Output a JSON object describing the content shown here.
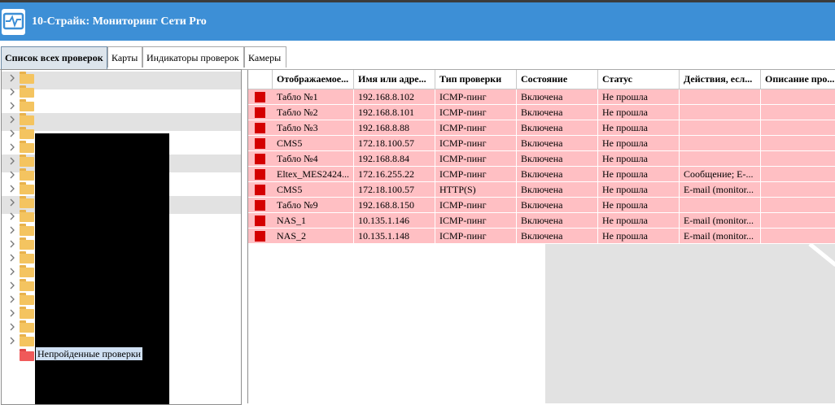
{
  "app": {
    "title": "10-Страйк: Мониторинг Сети Pro",
    "logo_icon": "pulse-monitor-icon"
  },
  "tabs": [
    {
      "label": "Список всех проверок",
      "active": true
    },
    {
      "label": "Карты",
      "active": false
    },
    {
      "label": "Индикаторы проверок",
      "active": false
    },
    {
      "label": "Камеры",
      "active": false
    }
  ],
  "tree": {
    "expand_icon": "chevron-right-icon",
    "folder_icon": "folder-icon",
    "folder_count": 20,
    "failed_checks_label": "Непройденные проверки"
  },
  "grid": {
    "columns": [
      "Отображаемое...",
      "Имя или адре...",
      "Тип проверки",
      "Состояние",
      "Статус",
      "Действия, есл...",
      "Описание про..."
    ],
    "rows": [
      {
        "name": "Табло №1",
        "address": "192.168.8.102",
        "type": "ICMP-пинг",
        "state": "Включена",
        "status": "Не прошла",
        "actions": "",
        "description": ""
      },
      {
        "name": "Табло №2",
        "address": "192.168.8.101",
        "type": "ICMP-пинг",
        "state": "Включена",
        "status": "Не прошла",
        "actions": "",
        "description": ""
      },
      {
        "name": "Табло №3",
        "address": "192.168.8.88",
        "type": "ICMP-пинг",
        "state": "Включена",
        "status": "Не прошла",
        "actions": "",
        "description": ""
      },
      {
        "name": "CMS5",
        "address": "172.18.100.57",
        "type": "ICMP-пинг",
        "state": "Включена",
        "status": "Не прошла",
        "actions": "",
        "description": ""
      },
      {
        "name": "Табло №4",
        "address": "192.168.8.84",
        "type": "ICMP-пинг",
        "state": "Включена",
        "status": "Не прошла",
        "actions": "",
        "description": ""
      },
      {
        "name": "Eltex_MES2424...",
        "address": "172.16.255.22",
        "type": "ICMP-пинг",
        "state": "Включена",
        "status": "Не прошла",
        "actions": "Сообщение; E-...",
        "description": ""
      },
      {
        "name": "CMS5",
        "address": "172.18.100.57",
        "type": "HTTP(S)",
        "state": "Включена",
        "status": "Не прошла",
        "actions": "E-mail (monitor...",
        "description": ""
      },
      {
        "name": "Табло №9",
        "address": "192.168.8.150",
        "type": "ICMP-пинг",
        "state": "Включена",
        "status": "Не прошла",
        "actions": "",
        "description": ""
      },
      {
        "name": "NAS_1",
        "address": "10.135.1.146",
        "type": "ICMP-пинг",
        "state": "Включена",
        "status": "Не прошла",
        "actions": "E-mail (monitor...",
        "description": ""
      },
      {
        "name": "NAS_2",
        "address": "10.135.1.148",
        "type": "ICMP-пинг",
        "state": "Включена",
        "status": "Не прошла",
        "actions": "E-mail (monitor...",
        "description": ""
      }
    ]
  },
  "colors": {
    "titlebar": "#3d8fd6",
    "failed_row": "#ffbfc3",
    "failed_marker": "#d40000"
  }
}
